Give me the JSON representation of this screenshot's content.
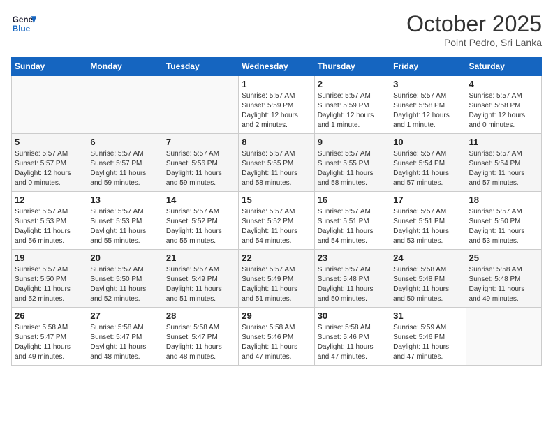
{
  "logo": {
    "line1": "General",
    "line2": "Blue"
  },
  "title": "October 2025",
  "subtitle": "Point Pedro, Sri Lanka",
  "days_of_week": [
    "Sunday",
    "Monday",
    "Tuesday",
    "Wednesday",
    "Thursday",
    "Friday",
    "Saturday"
  ],
  "weeks": [
    [
      {
        "day": "",
        "info": ""
      },
      {
        "day": "",
        "info": ""
      },
      {
        "day": "",
        "info": ""
      },
      {
        "day": "1",
        "info": "Sunrise: 5:57 AM\nSunset: 5:59 PM\nDaylight: 12 hours\nand 2 minutes."
      },
      {
        "day": "2",
        "info": "Sunrise: 5:57 AM\nSunset: 5:59 PM\nDaylight: 12 hours\nand 1 minute."
      },
      {
        "day": "3",
        "info": "Sunrise: 5:57 AM\nSunset: 5:58 PM\nDaylight: 12 hours\nand 1 minute."
      },
      {
        "day": "4",
        "info": "Sunrise: 5:57 AM\nSunset: 5:58 PM\nDaylight: 12 hours\nand 0 minutes."
      }
    ],
    [
      {
        "day": "5",
        "info": "Sunrise: 5:57 AM\nSunset: 5:57 PM\nDaylight: 12 hours\nand 0 minutes."
      },
      {
        "day": "6",
        "info": "Sunrise: 5:57 AM\nSunset: 5:57 PM\nDaylight: 11 hours\nand 59 minutes."
      },
      {
        "day": "7",
        "info": "Sunrise: 5:57 AM\nSunset: 5:56 PM\nDaylight: 11 hours\nand 59 minutes."
      },
      {
        "day": "8",
        "info": "Sunrise: 5:57 AM\nSunset: 5:55 PM\nDaylight: 11 hours\nand 58 minutes."
      },
      {
        "day": "9",
        "info": "Sunrise: 5:57 AM\nSunset: 5:55 PM\nDaylight: 11 hours\nand 58 minutes."
      },
      {
        "day": "10",
        "info": "Sunrise: 5:57 AM\nSunset: 5:54 PM\nDaylight: 11 hours\nand 57 minutes."
      },
      {
        "day": "11",
        "info": "Sunrise: 5:57 AM\nSunset: 5:54 PM\nDaylight: 11 hours\nand 57 minutes."
      }
    ],
    [
      {
        "day": "12",
        "info": "Sunrise: 5:57 AM\nSunset: 5:53 PM\nDaylight: 11 hours\nand 56 minutes."
      },
      {
        "day": "13",
        "info": "Sunrise: 5:57 AM\nSunset: 5:53 PM\nDaylight: 11 hours\nand 55 minutes."
      },
      {
        "day": "14",
        "info": "Sunrise: 5:57 AM\nSunset: 5:52 PM\nDaylight: 11 hours\nand 55 minutes."
      },
      {
        "day": "15",
        "info": "Sunrise: 5:57 AM\nSunset: 5:52 PM\nDaylight: 11 hours\nand 54 minutes."
      },
      {
        "day": "16",
        "info": "Sunrise: 5:57 AM\nSunset: 5:51 PM\nDaylight: 11 hours\nand 54 minutes."
      },
      {
        "day": "17",
        "info": "Sunrise: 5:57 AM\nSunset: 5:51 PM\nDaylight: 11 hours\nand 53 minutes."
      },
      {
        "day": "18",
        "info": "Sunrise: 5:57 AM\nSunset: 5:50 PM\nDaylight: 11 hours\nand 53 minutes."
      }
    ],
    [
      {
        "day": "19",
        "info": "Sunrise: 5:57 AM\nSunset: 5:50 PM\nDaylight: 11 hours\nand 52 minutes."
      },
      {
        "day": "20",
        "info": "Sunrise: 5:57 AM\nSunset: 5:50 PM\nDaylight: 11 hours\nand 52 minutes."
      },
      {
        "day": "21",
        "info": "Sunrise: 5:57 AM\nSunset: 5:49 PM\nDaylight: 11 hours\nand 51 minutes."
      },
      {
        "day": "22",
        "info": "Sunrise: 5:57 AM\nSunset: 5:49 PM\nDaylight: 11 hours\nand 51 minutes."
      },
      {
        "day": "23",
        "info": "Sunrise: 5:57 AM\nSunset: 5:48 PM\nDaylight: 11 hours\nand 50 minutes."
      },
      {
        "day": "24",
        "info": "Sunrise: 5:58 AM\nSunset: 5:48 PM\nDaylight: 11 hours\nand 50 minutes."
      },
      {
        "day": "25",
        "info": "Sunrise: 5:58 AM\nSunset: 5:48 PM\nDaylight: 11 hours\nand 49 minutes."
      }
    ],
    [
      {
        "day": "26",
        "info": "Sunrise: 5:58 AM\nSunset: 5:47 PM\nDaylight: 11 hours\nand 49 minutes."
      },
      {
        "day": "27",
        "info": "Sunrise: 5:58 AM\nSunset: 5:47 PM\nDaylight: 11 hours\nand 48 minutes."
      },
      {
        "day": "28",
        "info": "Sunrise: 5:58 AM\nSunset: 5:47 PM\nDaylight: 11 hours\nand 48 minutes."
      },
      {
        "day": "29",
        "info": "Sunrise: 5:58 AM\nSunset: 5:46 PM\nDaylight: 11 hours\nand 47 minutes."
      },
      {
        "day": "30",
        "info": "Sunrise: 5:58 AM\nSunset: 5:46 PM\nDaylight: 11 hours\nand 47 minutes."
      },
      {
        "day": "31",
        "info": "Sunrise: 5:59 AM\nSunset: 5:46 PM\nDaylight: 11 hours\nand 47 minutes."
      },
      {
        "day": "",
        "info": ""
      }
    ]
  ]
}
